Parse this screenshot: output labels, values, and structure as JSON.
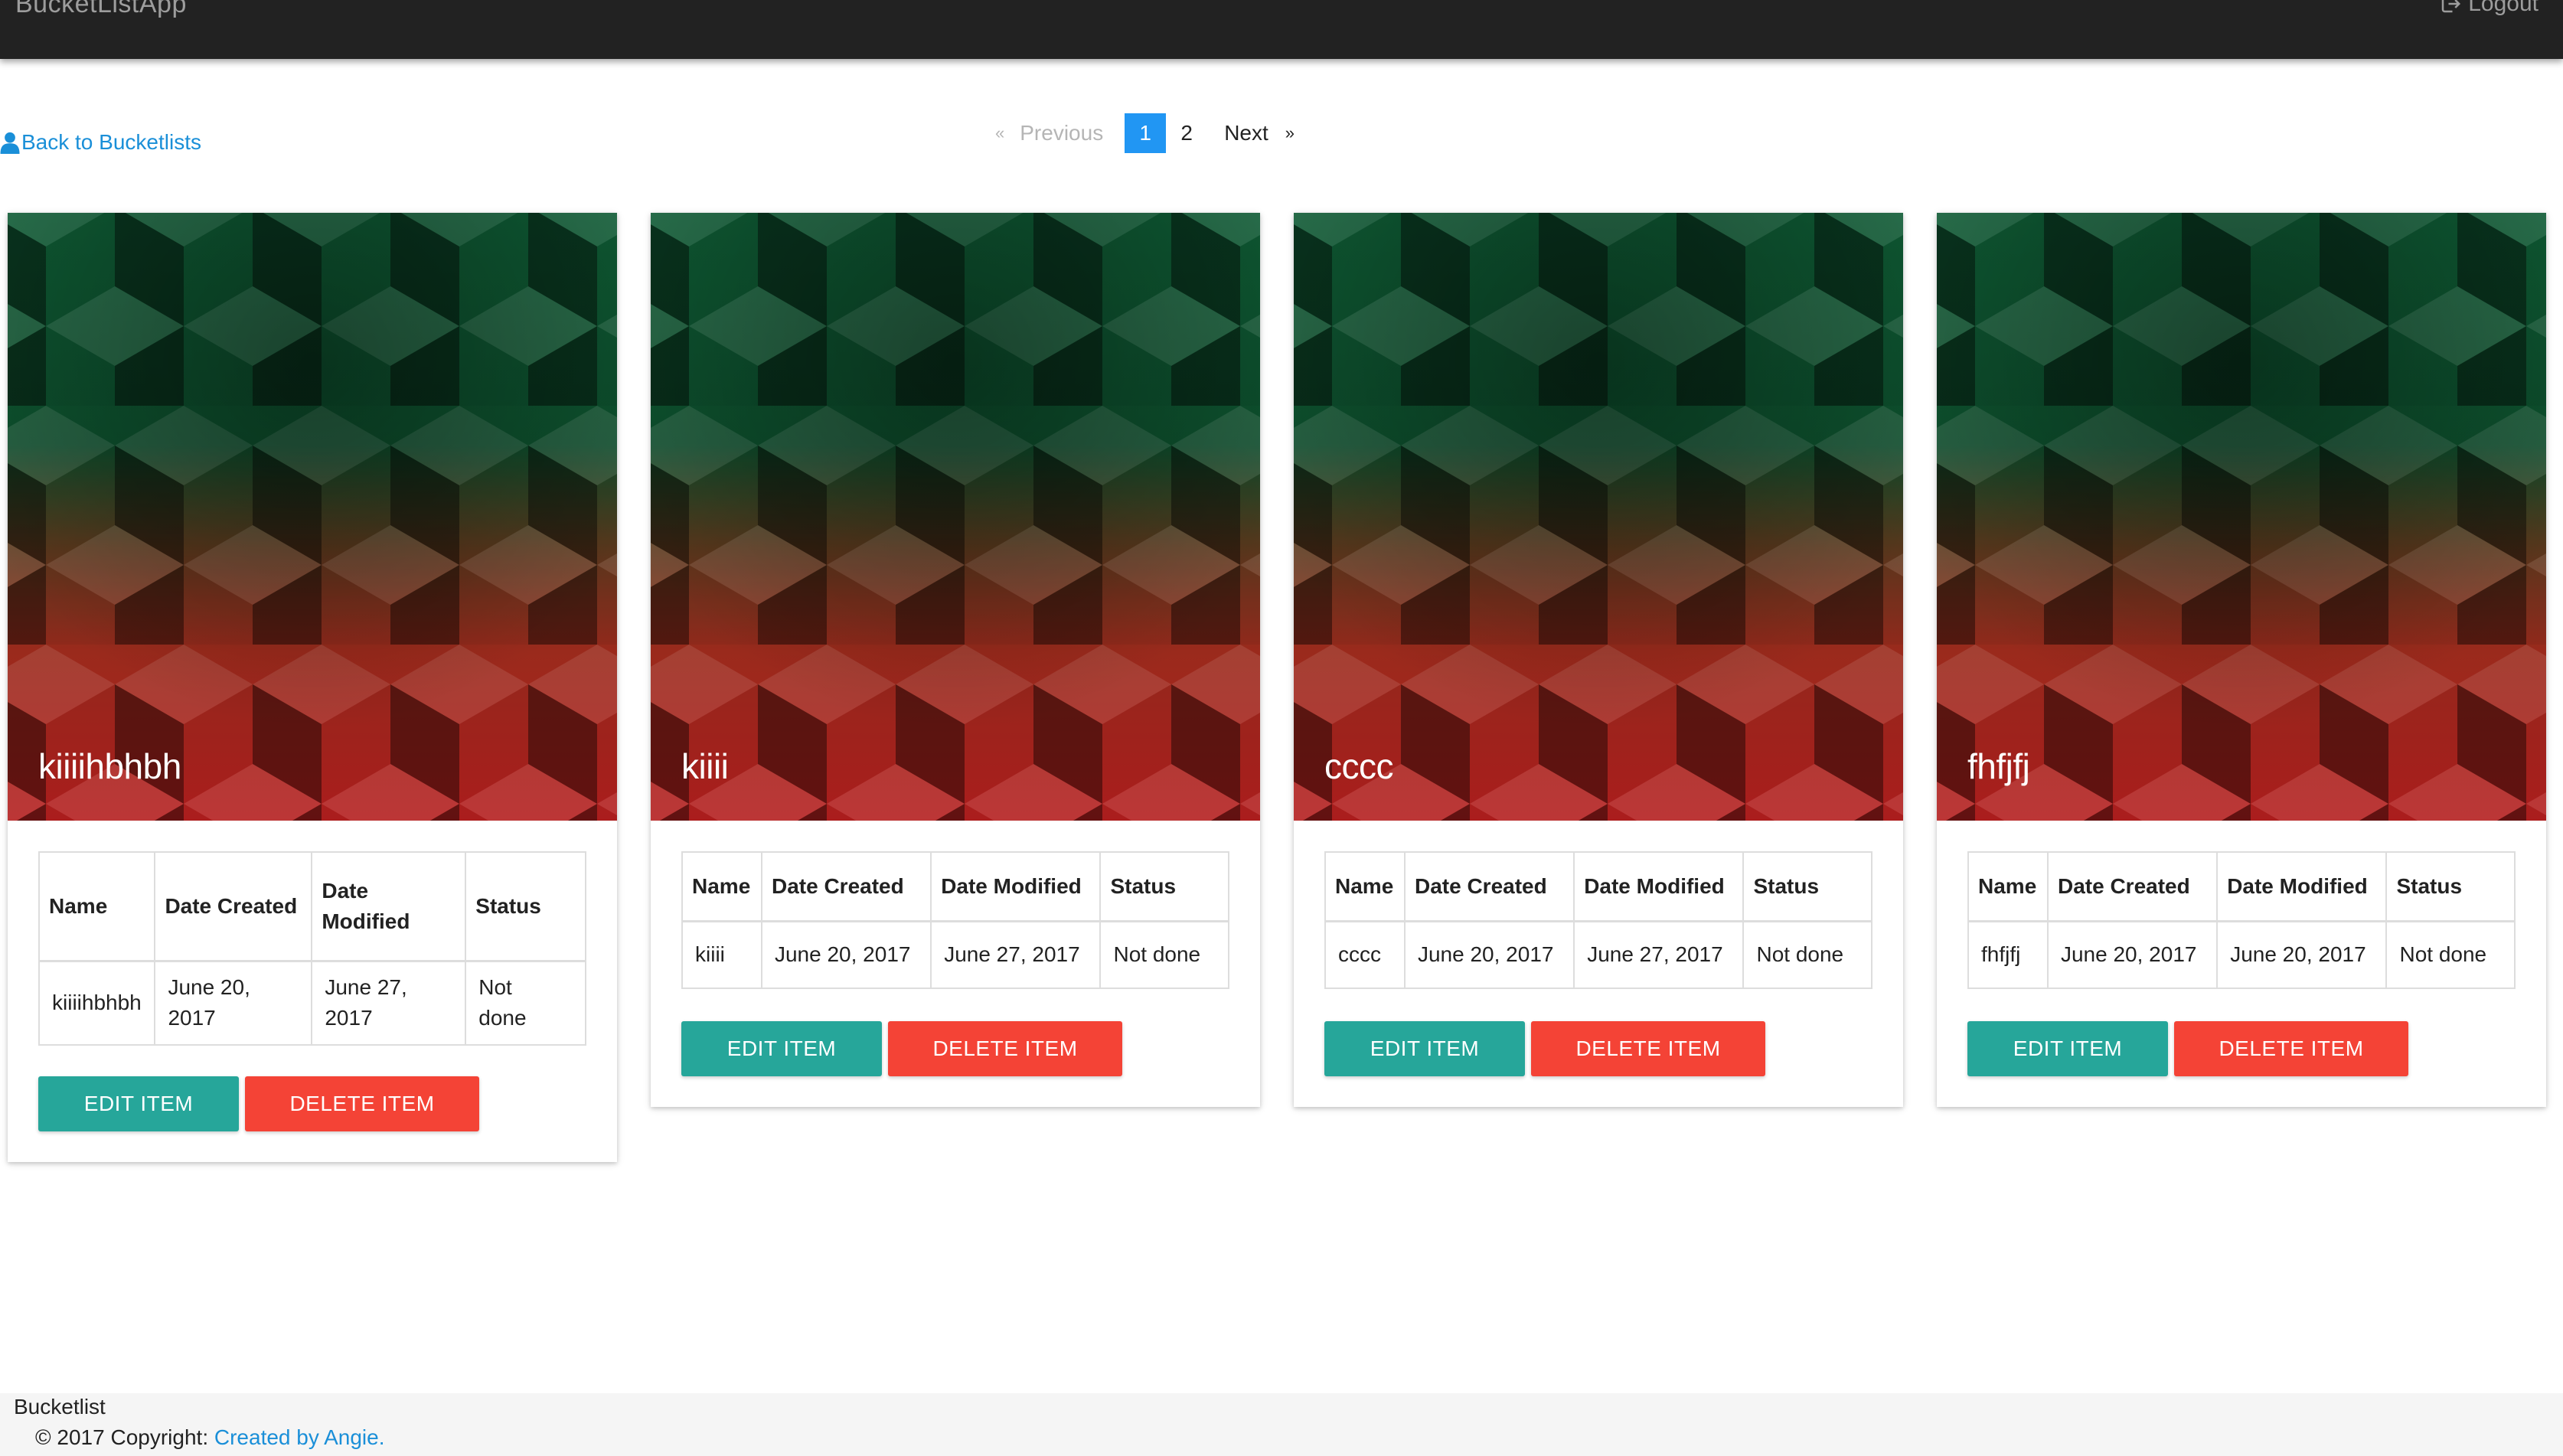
{
  "navbar": {
    "brand": "BucketListApp",
    "logout_label": "Logout"
  },
  "back_link": "Back to Bucketlists",
  "pagination": {
    "prev_label": "Previous",
    "prev_chev": "«",
    "pages": [
      "1",
      "2"
    ],
    "active_page": "1",
    "next_label": "Next",
    "next_chev": "»"
  },
  "table_headers": {
    "name": "Name",
    "date_created": "Date Created",
    "date_modified": "Date Modified",
    "status": "Status"
  },
  "buttons": {
    "edit": "EDIT ITEM",
    "delete": "DELETE ITEM"
  },
  "items": [
    {
      "title": "kiiiihbhbh",
      "name": "kiiiihbhbh",
      "date_created": "June 20, 2017",
      "date_modified": "June 27, 2017",
      "status": "Not done"
    },
    {
      "title": "kiiii",
      "name": "kiiii",
      "date_created": "June 20, 2017",
      "date_modified": "June 27, 2017",
      "status": "Not done"
    },
    {
      "title": "cccc",
      "name": "cccc",
      "date_created": "June 20, 2017",
      "date_modified": "June 27, 2017",
      "status": "Not done"
    },
    {
      "title": "fhfjfj",
      "name": "fhfjfj",
      "date_created": "June 20, 2017",
      "date_modified": "June 20, 2017",
      "status": "Not done"
    }
  ],
  "footer": {
    "title": "Bucketlist",
    "copyright": "© 2017 Copyright: ",
    "link_text": "Created by Angie."
  },
  "colors": {
    "navbar_bg": "#222222",
    "link_blue": "#1a8fd8",
    "active_page_bg": "#2196f3",
    "edit_button": "#26a69a",
    "delete_button": "#f44336",
    "pattern_top": "#0f5b34",
    "pattern_bottom": "#b01e1e"
  }
}
